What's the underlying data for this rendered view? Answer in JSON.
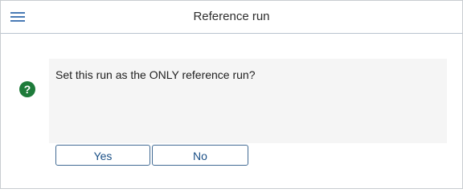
{
  "dialog": {
    "title": "Reference run",
    "menu_icon": "hamburger-menu-icon",
    "icon": "question-circle-icon",
    "icon_glyph": "?",
    "message": "Set this run as the ONLY reference run?",
    "buttons": {
      "yes_label": "Yes",
      "no_label": "No"
    }
  },
  "colors": {
    "accent": "#4a7bb5",
    "icon_green": "#1e7b3a",
    "button_text": "#1a4f86",
    "message_bg": "#f5f5f5"
  }
}
